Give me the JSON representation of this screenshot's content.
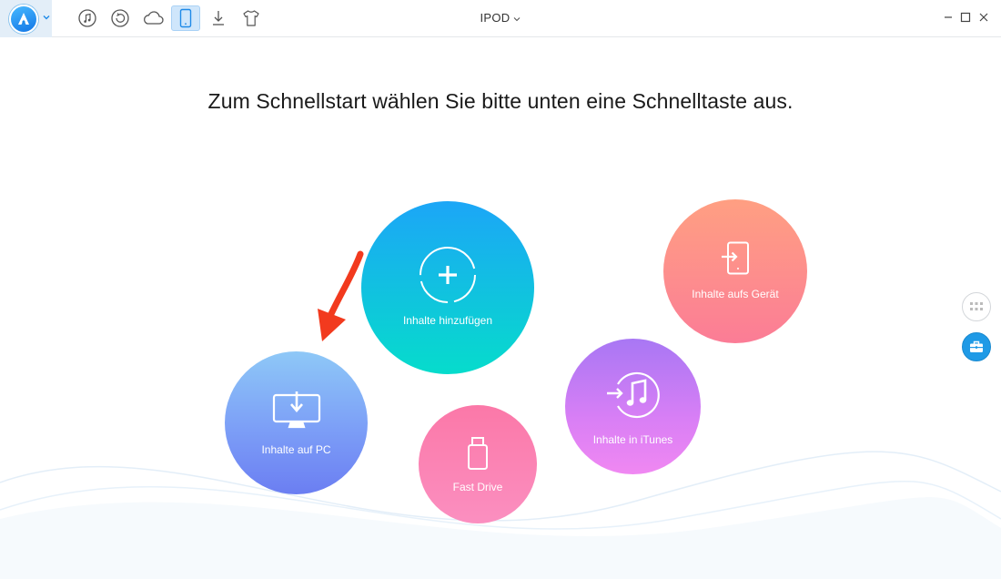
{
  "app": {
    "device_name": "IPOD"
  },
  "toolbar": {
    "icons": [
      "music-icon",
      "backup-icon",
      "cloud-icon",
      "phone-icon",
      "download-icon",
      "tshirt-icon"
    ],
    "active": "phone-icon"
  },
  "main": {
    "heading": "Zum Schnellstart wählen Sie bitte unten eine Schnelltaste aus."
  },
  "shortcuts": {
    "add_content": {
      "label": "Inhalte hinzufügen",
      "icon": "add-circle-icon"
    },
    "content_to_pc": {
      "label": "Inhalte auf PC",
      "icon": "monitor-download-icon"
    },
    "fast_drive": {
      "label": "Fast Drive",
      "icon": "usb-drive-icon"
    },
    "content_to_itunes": {
      "label": "Inhalte in iTunes",
      "icon": "itunes-transfer-icon"
    },
    "content_to_device": {
      "label": "Inhalte aufs Gerät",
      "icon": "phone-import-icon"
    }
  },
  "side": {
    "icons": [
      "grid-icon",
      "toolbox-icon"
    ]
  },
  "colors": {
    "accent": "#1f9ae6",
    "arrow": "#f23a1e"
  }
}
